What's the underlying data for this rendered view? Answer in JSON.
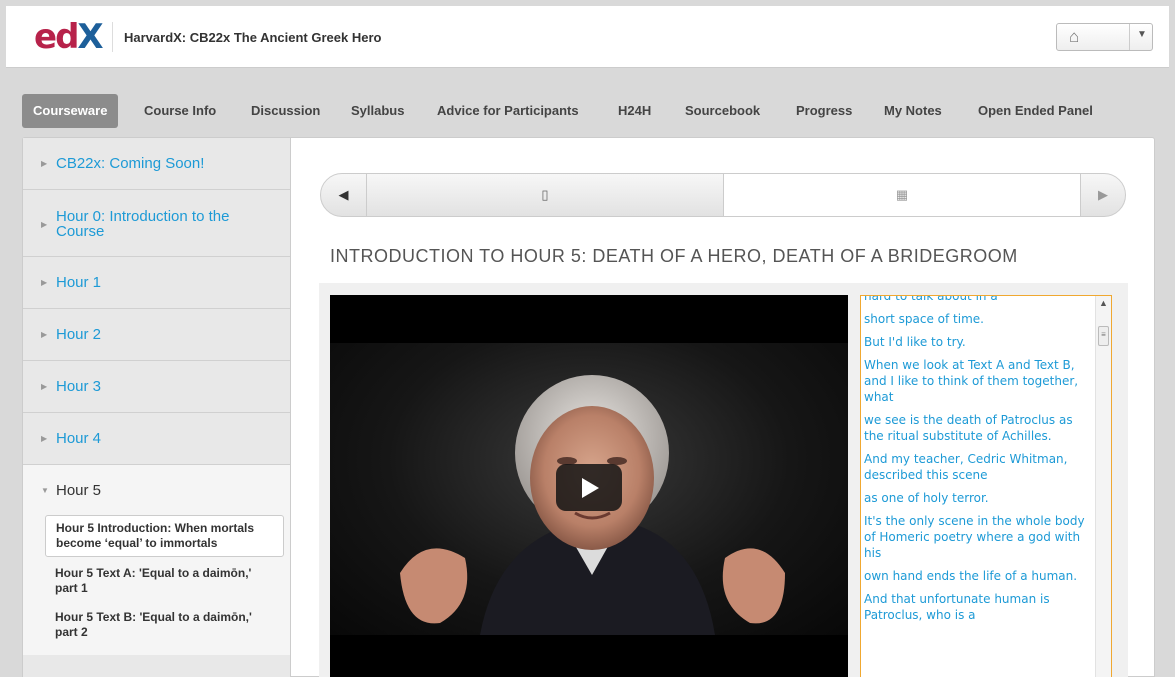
{
  "header": {
    "logo": {
      "e": "e",
      "d": "d",
      "x": "X"
    },
    "course_title": "HarvardX: CB22x The Ancient Greek Hero",
    "home_icon": "home-icon"
  },
  "tabs": [
    {
      "label": "Courseware",
      "active": true
    },
    {
      "label": "Course Info"
    },
    {
      "label": "Discussion"
    },
    {
      "label": "Syllabus"
    },
    {
      "label": "Advice for Participants"
    },
    {
      "label": "H24H"
    },
    {
      "label": "Sourcebook"
    },
    {
      "label": "Progress"
    },
    {
      "label": "My Notes"
    },
    {
      "label": "Open Ended Panel"
    }
  ],
  "sidebar": {
    "chapters": [
      {
        "label": "CB22x: Coming Soon!"
      },
      {
        "label": "Hour 0: Introduction to the Course"
      },
      {
        "label": "Hour 1"
      },
      {
        "label": "Hour 2"
      },
      {
        "label": "Hour 3"
      },
      {
        "label": "Hour 4"
      },
      {
        "label": "Hour 5"
      }
    ],
    "subsections": [
      {
        "label": "Hour 5 Introduction: When mortals become ‘equal’ to immortals",
        "active": true
      },
      {
        "label": "Hour 5 Text A: 'Equal to a daimōn,' part 1"
      },
      {
        "label": "Hour 5 Text B: 'Equal to a daimōn,' part 2"
      }
    ]
  },
  "sequence_nav": {
    "prev_icon": "left-arrow-icon",
    "item1_icon": "document-icon",
    "item2_icon": "video-icon",
    "next_icon": "right-arrow-icon"
  },
  "unit_title": "INTRODUCTION TO HOUR 5: DEATH OF A HERO, DEATH OF A BRIDEGROOM",
  "video": {
    "play_icon": "play-icon"
  },
  "transcript": [
    "hard to talk about in a",
    "short space of time.",
    "But I'd like to try.",
    "When we look at Text A and Text B, and I like to think of them together, what",
    "we see is the death of Patroclus as the ritual substitute of Achilles.",
    "And my teacher, Cedric Whitman, described this scene",
    "as one of holy terror.",
    "It's the only scene in the whole body of Homeric poetry where a god with his",
    "own hand ends the life of a human.",
    "And that unfortunate human is Patroclus, who is a"
  ]
}
